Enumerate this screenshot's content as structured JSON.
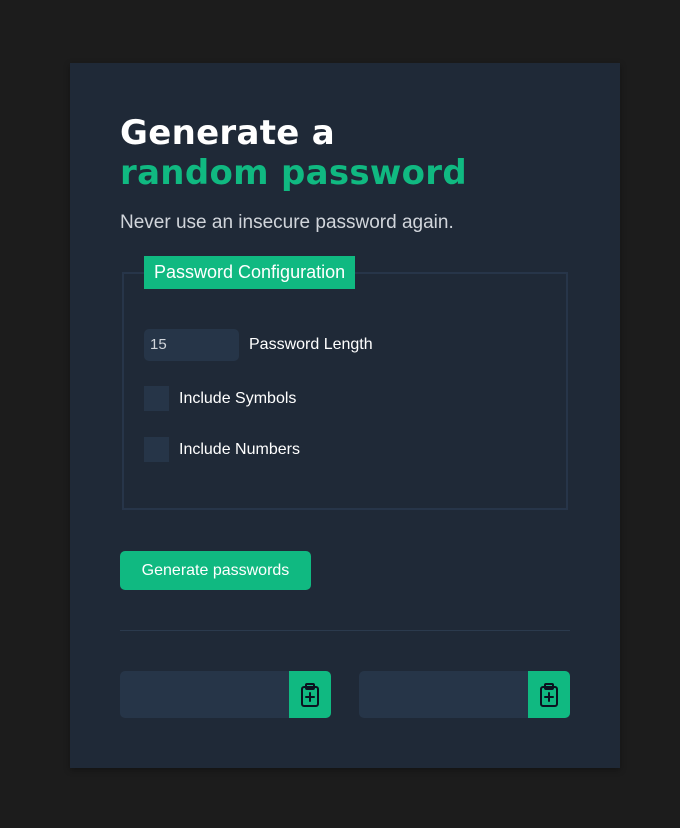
{
  "heading": {
    "line1": "Generate a",
    "line2": "random password"
  },
  "subtitle": "Never use an insecure password again.",
  "config": {
    "legend": "Password Configuration",
    "length_value": "15",
    "length_label": "Password Length",
    "symbols_label": "Include Symbols",
    "symbols_checked": false,
    "numbers_label": "Include Numbers",
    "numbers_checked": false
  },
  "generate_button": "Generate passwords",
  "outputs": [
    {
      "value": "",
      "copy_icon": "clipboard-plus-icon"
    },
    {
      "value": "",
      "copy_icon": "clipboard-plus-icon"
    }
  ],
  "colors": {
    "accent": "#10b981",
    "card_bg": "#1f2937",
    "page_bg": "#1c1c1c",
    "input_bg": "#263548"
  }
}
